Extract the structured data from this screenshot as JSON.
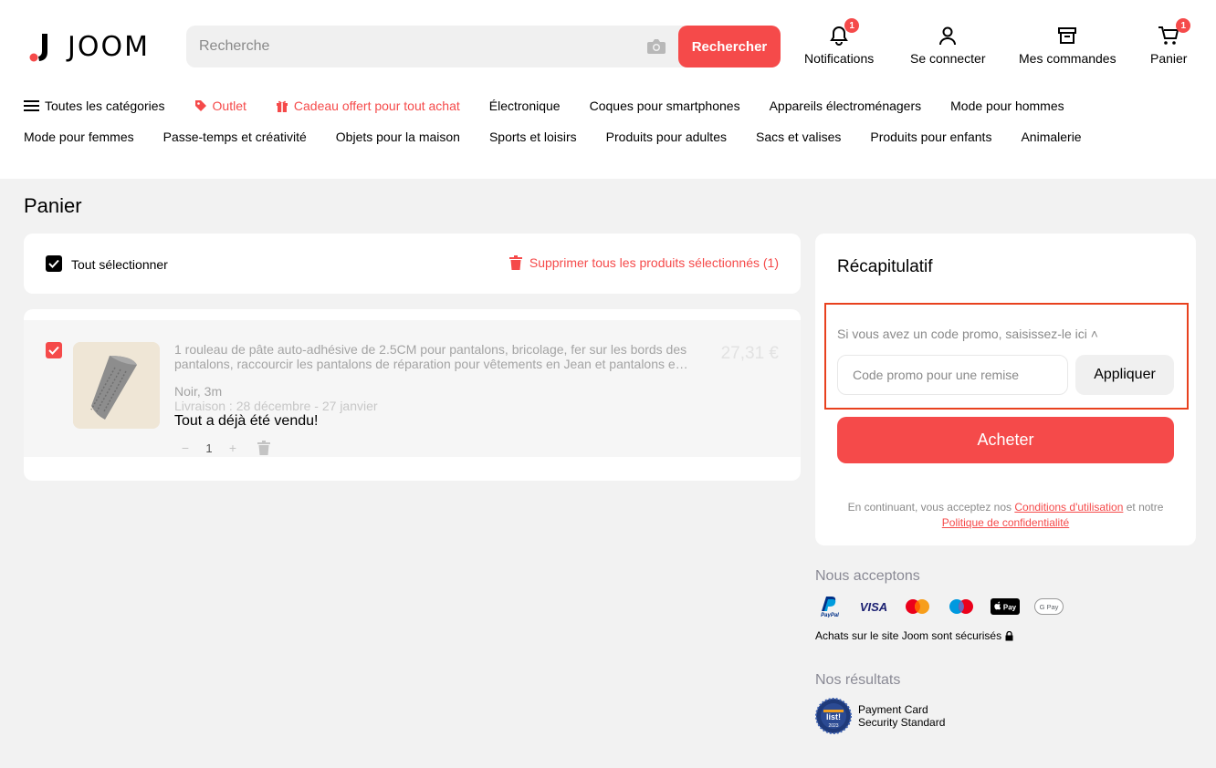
{
  "header": {
    "logo_text": "JOOM",
    "search_placeholder": "Recherche",
    "search_button": "Rechercher",
    "icons": [
      {
        "label": "Notifications",
        "badge": "1"
      },
      {
        "label": "Se connecter"
      },
      {
        "label": "Mes commandes"
      },
      {
        "label": "Panier",
        "badge": "1"
      }
    ]
  },
  "nav": {
    "row1": [
      "Toutes les catégories",
      "Outlet",
      "Cadeau offert pour tout achat",
      "Électronique",
      "Coques pour smartphones",
      "Appareils électroménagers",
      "Mode pour hommes"
    ],
    "row2": [
      "Mode pour femmes",
      "Passe-temps et créativité",
      "Objets pour la maison",
      "Sports et loisirs",
      "Produits pour adultes",
      "Sacs et valises",
      "Produits pour enfants",
      "Animalerie"
    ]
  },
  "page": {
    "title": "Panier"
  },
  "cart": {
    "select_all": "Tout sélectionner",
    "delete_selected": "Supprimer tous les produits sélectionnés (1)",
    "product": {
      "title": "1 rouleau de pâte auto-adhésive de 2.5CM pour pantalons, bricolage, fer sur les bords des pantalons, raccourcir les pantalons de réparation pour vêtements en Jean et pantalons e…",
      "price": "27,31 €",
      "variant": "Noir, 3m",
      "delivery": "Livraison : 28 décembre - 27 janvier",
      "status": "Tout a déjà été vendu!",
      "quantity": "1",
      "minus": "−",
      "plus": "+"
    }
  },
  "summary": {
    "title": "Récapitulatif",
    "promo_label": "Si vous avez un code promo, saisissez-le ici ˄",
    "promo_placeholder": "Code promo pour une remise",
    "apply_button": "Appliquer",
    "buy_button": "Acheter",
    "legal_prefix": "En continuant, vous acceptez nos ",
    "terms_link": "Conditions d'utilisation",
    "legal_middle": " et notre ",
    "privacy_link": "Politique de confidentialité"
  },
  "accept": {
    "title": "Nous acceptons",
    "methods": [
      "PayPal",
      "VISA",
      "Mastercard",
      "Maestro",
      "Apple Pay",
      "Google Pay"
    ],
    "secure_text": "Achats sur le site Joom sont sécurisés"
  },
  "results": {
    "title": "Nos résultats",
    "pci_line1": "Payment Card",
    "pci_line2": "Security Standard",
    "badge_year": "2023"
  },
  "colors": {
    "accent": "#f54a4a",
    "highlight_border": "#e8411e",
    "background": "#f2f2f2"
  }
}
